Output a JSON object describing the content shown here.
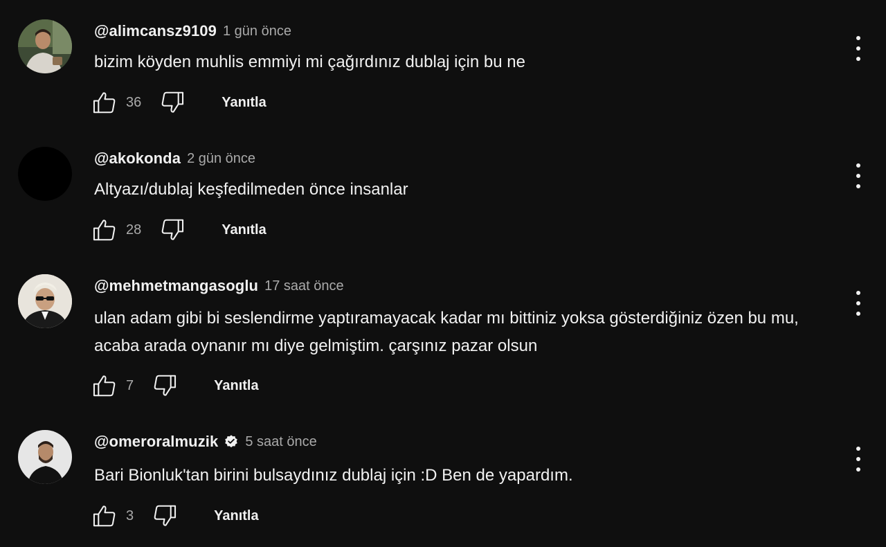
{
  "comments": [
    {
      "author": "@alimcansz9109",
      "time": "1 gün önce",
      "text": "bizim köyden muhlis emmiyi mi çağırdınız dublaj için bu ne",
      "likes": "36",
      "reply_label": "Yanıtla",
      "verified": false
    },
    {
      "author": "@akokonda",
      "time": "2 gün önce",
      "text": "Altyazı/dublaj keşfedilmeden önce insanlar",
      "likes": "28",
      "reply_label": "Yanıtla",
      "verified": false
    },
    {
      "author": "@mehmetmangasoglu",
      "time": "17 saat önce",
      "text": "ulan adam gibi bi seslendirme yaptıramayacak kadar mı bittiniz yoksa gösterdiğiniz özen bu mu, acaba arada oynanır mı diye gelmiştim. çarşınız pazar olsun",
      "likes": "7",
      "reply_label": "Yanıtla",
      "verified": false
    },
    {
      "author": "@omeroralmuzik",
      "time": "5 saat önce",
      "text": "Bari Bionluk'tan birini bulsaydınız dublaj için :D Ben de yapardım.",
      "likes": "3",
      "reply_label": "Yanıtla",
      "verified": true
    }
  ],
  "icons": {
    "like": "thumb-up-icon",
    "dislike": "thumb-down-icon",
    "menu": "more-vert-icon",
    "verified": "verified-badge-icon"
  },
  "colors": {
    "background": "#0f0f0f",
    "primary_text": "#f1f1f1",
    "secondary_text": "#aaaaaa"
  }
}
